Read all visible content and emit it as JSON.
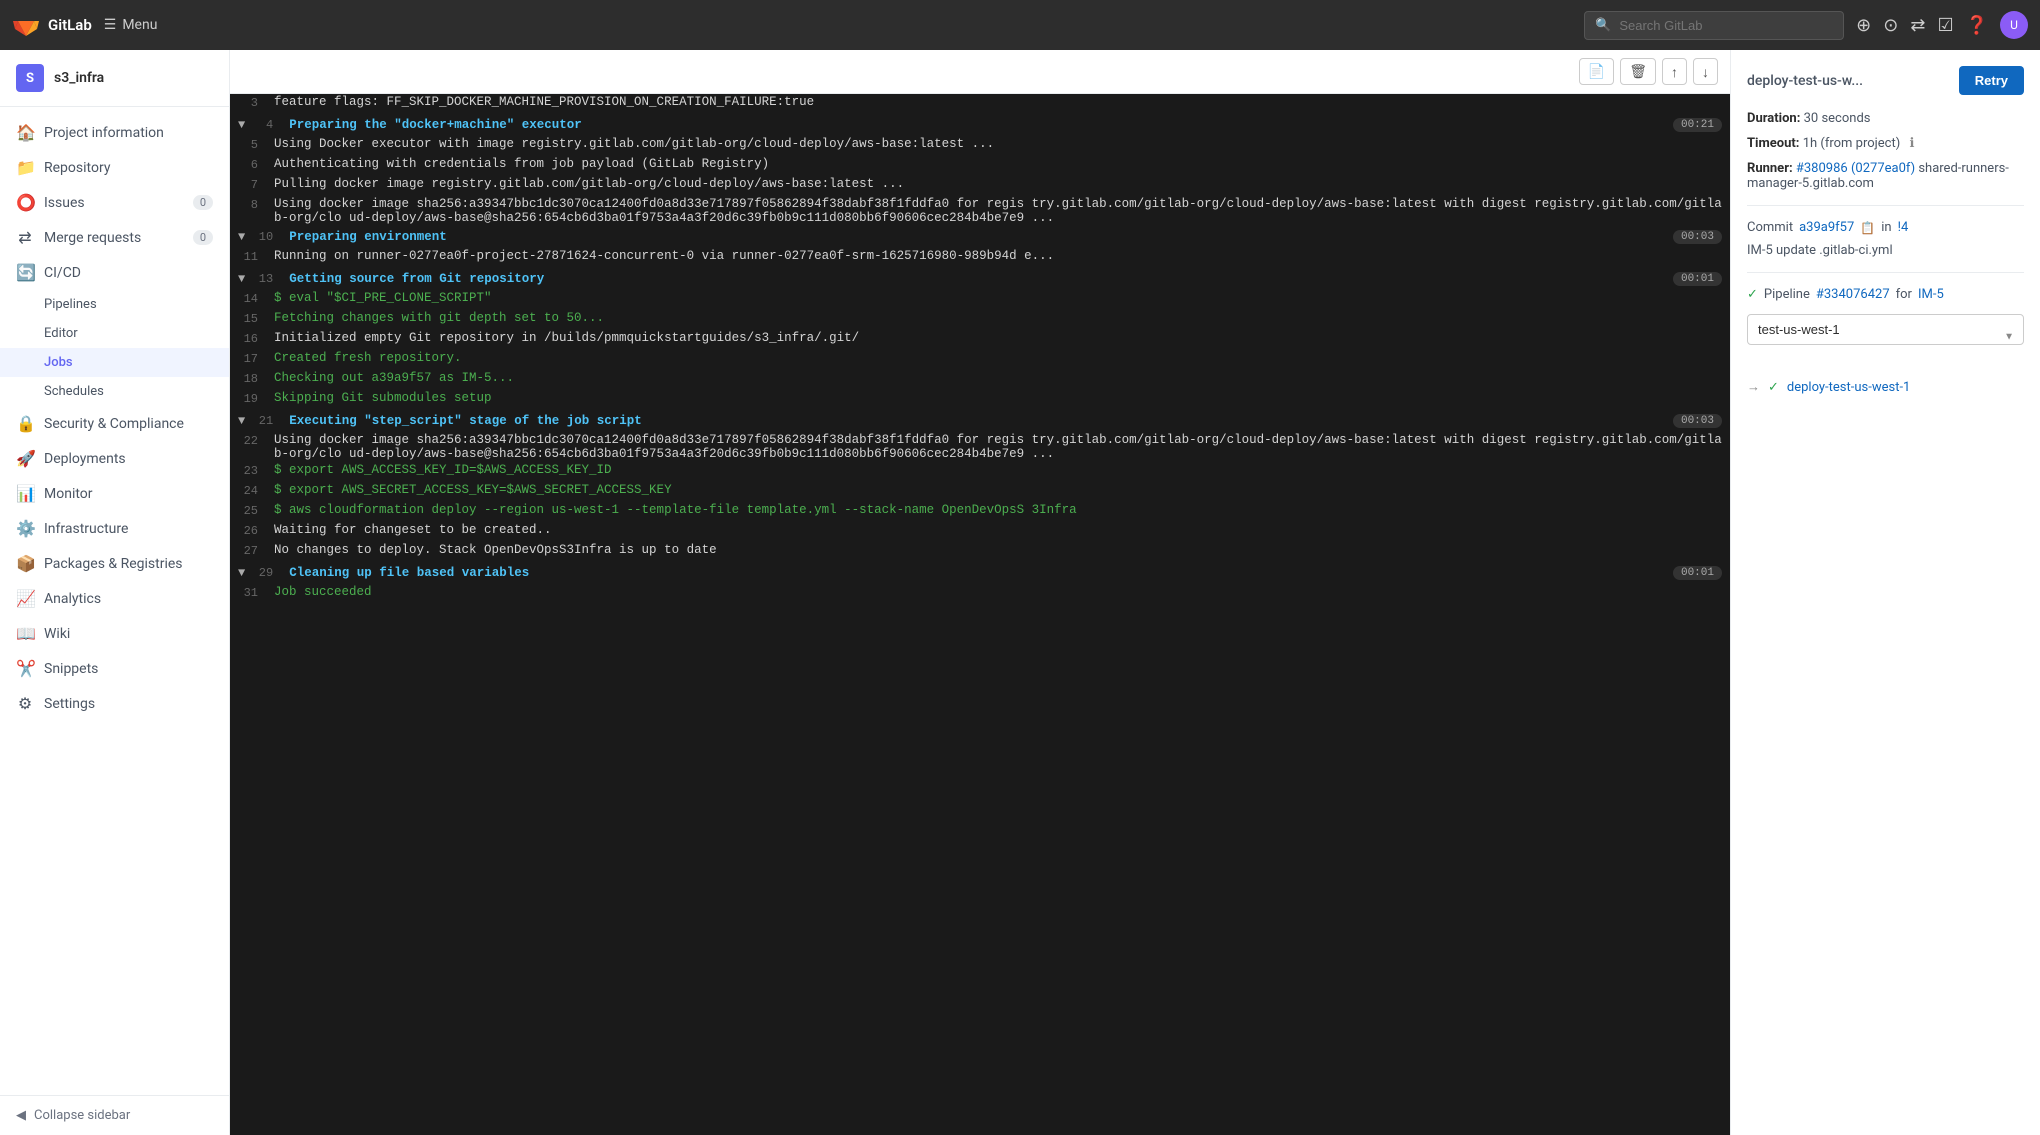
{
  "navbar": {
    "brand": "GitLab",
    "menu_label": "Menu",
    "search_placeholder": "Search GitLab",
    "avatar_initials": "U"
  },
  "sidebar": {
    "project_initial": "S",
    "project_name": "s3_infra",
    "items": [
      {
        "id": "project-information",
        "label": "Project information",
        "icon": "🏠"
      },
      {
        "id": "repository",
        "label": "Repository",
        "icon": "📁"
      },
      {
        "id": "issues",
        "label": "Issues",
        "icon": "⭕",
        "badge": "0"
      },
      {
        "id": "merge-requests",
        "label": "Merge requests",
        "icon": "⇄",
        "badge": "0"
      },
      {
        "id": "cicd",
        "label": "CI/CD",
        "icon": "🔄",
        "expanded": true
      },
      {
        "id": "pipelines",
        "label": "Pipelines",
        "icon": "",
        "sub": true
      },
      {
        "id": "editor",
        "label": "Editor",
        "icon": "",
        "sub": true
      },
      {
        "id": "jobs",
        "label": "Jobs",
        "icon": "",
        "sub": true,
        "active": true
      },
      {
        "id": "schedules",
        "label": "Schedules",
        "icon": "",
        "sub": true
      },
      {
        "id": "security-compliance",
        "label": "Security & Compliance",
        "icon": "🔒"
      },
      {
        "id": "deployments",
        "label": "Deployments",
        "icon": "🚀"
      },
      {
        "id": "monitor",
        "label": "Monitor",
        "icon": "📊"
      },
      {
        "id": "infrastructure",
        "label": "Infrastructure",
        "icon": "⚙️"
      },
      {
        "id": "packages-registries",
        "label": "Packages & Registries",
        "icon": "📦"
      },
      {
        "id": "analytics",
        "label": "Analytics",
        "icon": "📈"
      },
      {
        "id": "wiki",
        "label": "Wiki",
        "icon": "📖"
      },
      {
        "id": "snippets",
        "label": "Snippets",
        "icon": "✂️"
      },
      {
        "id": "settings",
        "label": "Settings",
        "icon": "⚙"
      }
    ],
    "collapse_label": "Collapse sidebar"
  },
  "log": {
    "lines": [
      {
        "num": "3",
        "type": "default",
        "content": "feature flags: FF_SKIP_DOCKER_MACHINE_PROVISION_ON_CREATION_FAILURE:true"
      },
      {
        "num": "5",
        "type": "default",
        "content": "Using Docker executor with image registry.gitlab.com/gitlab-org/cloud-deploy/aws-base:latest ..."
      },
      {
        "num": "6",
        "type": "default",
        "content": "Authenticating with credentials from job payload (GitLab Registry)"
      },
      {
        "num": "7",
        "type": "default",
        "content": "Pulling docker image registry.gitlab.com/gitlab-org/cloud-deploy/aws-base:latest ..."
      },
      {
        "num": "8",
        "type": "default",
        "content": "Using docker image sha256:a39347bbc1dc3070ca12400fd0a8d33e717897f05862894f38dabf38f1fddfa0 for registry.gitlab.com/gitlab-org/cloud-deploy/aws-base:latest with digest registry.gitlab.com/gitlab-org/cloud-deploy/aws-base@sha256:654cb6d3ba01f9753a4a3f20d6c39fb0b9c111d080bb6f90606cec284b4be7e9 ..."
      },
      {
        "num": "11",
        "type": "default",
        "content": "Running on runner-0277ea0f-project-27871624-concurrent-0 via runner-0277ea0f-srm-1625716980-989b94de..."
      },
      {
        "num": "14",
        "type": "green",
        "content": "$ eval \"$CI_PRE_CLONE_SCRIPT\""
      },
      {
        "num": "15",
        "type": "green",
        "content": "Fetching changes with git depth set to 50..."
      },
      {
        "num": "16",
        "type": "default",
        "content": "Initialized empty Git repository in /builds/pmmquickstartguides/s3_infra/.git/"
      },
      {
        "num": "17",
        "type": "green",
        "content": "Created fresh repository."
      },
      {
        "num": "18",
        "type": "green",
        "content": "Checking out a39a9f57 as IM-5..."
      },
      {
        "num": "19",
        "type": "green",
        "content": "Skipping Git submodules setup"
      },
      {
        "num": "22",
        "type": "default",
        "content": "Using docker image sha256:a39347bbc1dc3070ca12400fd0a8d33e717897f05862894f38dabf38f1fddfa0 for registry.gitlab.com/gitlab-org/cloud-deploy/aws-base:latest with digest registry.gitlab.com/gitlab-org/cloud-deploy/aws-base@sha256:654cb6d3ba01f9753a4a3f20d6c39fb0b9c111d080bb6f90606cec284b4be7e9 ..."
      },
      {
        "num": "23",
        "type": "green",
        "content": "$ export AWS_ACCESS_KEY_ID=$AWS_ACCESS_KEY_ID"
      },
      {
        "num": "24",
        "type": "green",
        "content": "$ export AWS_SECRET_ACCESS_KEY=$AWS_SECRET_ACCESS_KEY"
      },
      {
        "num": "25",
        "type": "green",
        "content": "$ aws cloudformation deploy --region us-west-1 --template-file template.yml --stack-name OpenDevOpsS3Infra"
      },
      {
        "num": "26",
        "type": "default",
        "content": "Waiting for changeset to be created.."
      },
      {
        "num": "27",
        "type": "default",
        "content": "No changes to deploy. Stack OpenDevOpsS3Infra is up to date"
      },
      {
        "num": "31",
        "type": "green",
        "content": "Job succeeded"
      }
    ],
    "sections": [
      {
        "num": "4",
        "text": "Preparing the \"docker+machine\" executor",
        "time": "00:21"
      },
      {
        "num": "10",
        "text": "Preparing environment",
        "time": "00:03"
      },
      {
        "num": "13",
        "text": "Getting source from Git repository",
        "time": "00:01"
      },
      {
        "num": "21",
        "text": "Executing \"step_script\" stage of the job script",
        "time": "00:03"
      },
      {
        "num": "29",
        "text": "Cleaning up file based variables",
        "time": "00:01"
      }
    ]
  },
  "right_panel": {
    "title": "deploy-test-us-w...",
    "retry_label": "Retry",
    "duration_label": "Duration:",
    "duration_value": "30 seconds",
    "timeout_label": "Timeout:",
    "timeout_value": "1h (from project)",
    "runner_label": "Runner:",
    "runner_id": "#380986",
    "runner_hash": "0277ea0f",
    "runner_name": "shared-runners-manager-5.gitlab.com",
    "commit_label": "Commit",
    "commit_hash": "a39a9f57",
    "commit_branch": "!4",
    "commit_message": "IM-5 update .gitlab-ci.yml",
    "pipeline_label": "Pipeline",
    "pipeline_id": "#334076427",
    "pipeline_branch": "IM-5",
    "pipeline_select_value": "test-us-west-1",
    "job_name": "deploy-test-us-west-1"
  }
}
